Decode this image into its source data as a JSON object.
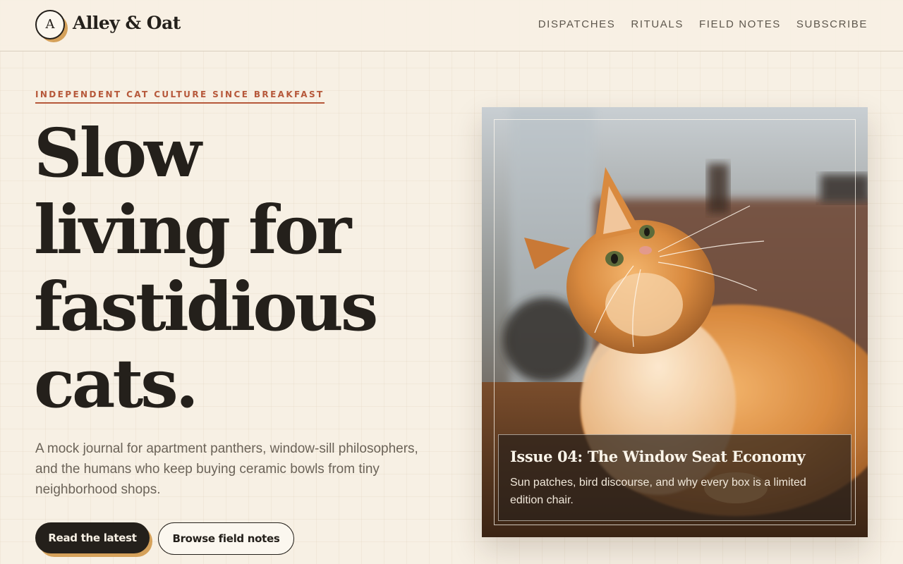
{
  "brand": {
    "logo_letter": "A",
    "name": "Alley & Oat"
  },
  "nav": {
    "items": [
      "DISPATCHES",
      "RITUALS",
      "FIELD NOTES",
      "SUBSCRIBE"
    ]
  },
  "hero": {
    "eyebrow": "INDEPENDENT CAT CULTURE SINCE BREAKFAST",
    "headline_lines": [
      "Slow",
      "living for",
      "fastidious",
      "cats."
    ],
    "lede": "A mock journal for apartment panthers, window-sill philosophers, and the humans who keep buying ceramic bowls from tiny neighborhood shops.",
    "primary_cta": "Read the latest",
    "secondary_cta": "Browse field notes"
  },
  "feature": {
    "image_alt": "orange-tabby-cat-photo",
    "title": "Issue 04: The Window Seat Economy",
    "description": "Sun patches, bird discourse, and why every box is a limited edition chair."
  },
  "colors": {
    "background": "#f7f0e4",
    "ink": "#24201b",
    "accent": "#b6583a",
    "gold": "#d5a15a",
    "muted_text": "#6b6358"
  }
}
